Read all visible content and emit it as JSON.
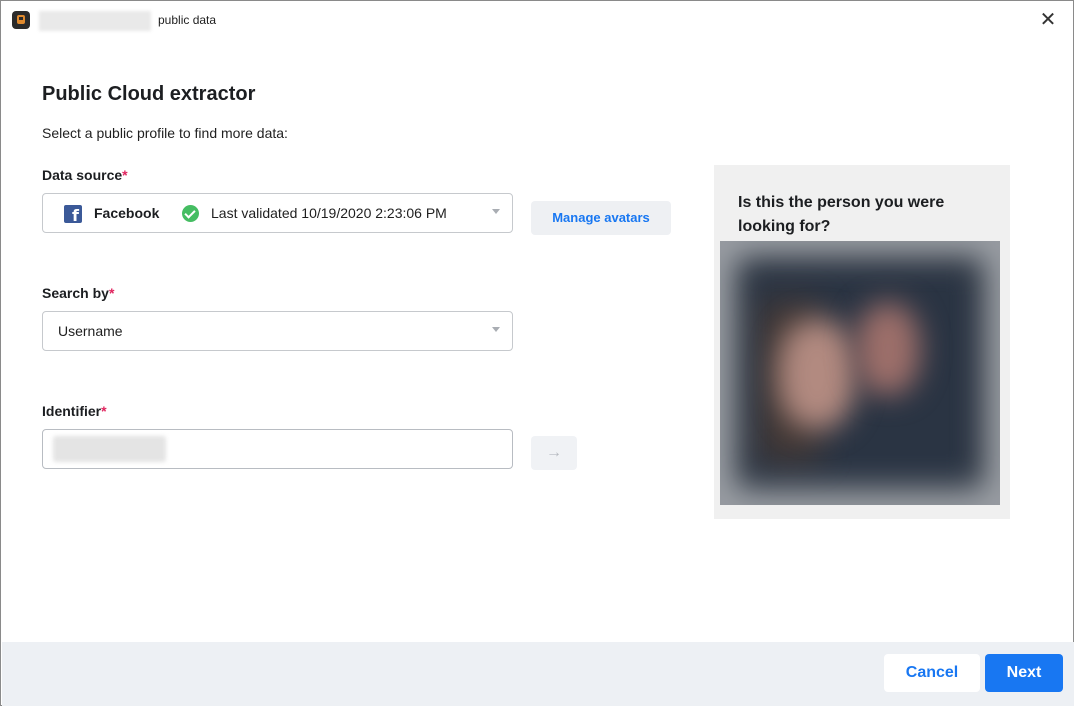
{
  "window": {
    "title": "public data",
    "close_glyph": "✕"
  },
  "header": {
    "heading": "Public Cloud extractor",
    "subtitle": "Select a public profile to find more data:"
  },
  "data_source": {
    "label": "Data source",
    "required_mark": "*",
    "network": "Facebook",
    "network_icon_glyph": "f",
    "status": "Last validated 10/19/2020 2:23:06 PM",
    "status_icon": "check-circle-icon",
    "brand_color": "#3b5998",
    "status_color": "#45bd62"
  },
  "manage_avatars": {
    "label": "Manage avatars"
  },
  "search_by": {
    "label": "Search by",
    "required_mark": "*",
    "value": "Username"
  },
  "identifier": {
    "label": "Identifier",
    "required_mark": "*",
    "submit_glyph": "→"
  },
  "preview": {
    "question": "Is this the person you were looking for?"
  },
  "footer": {
    "cancel_label": "Cancel",
    "next_label": "Next",
    "accent_color": "#1877f2"
  }
}
